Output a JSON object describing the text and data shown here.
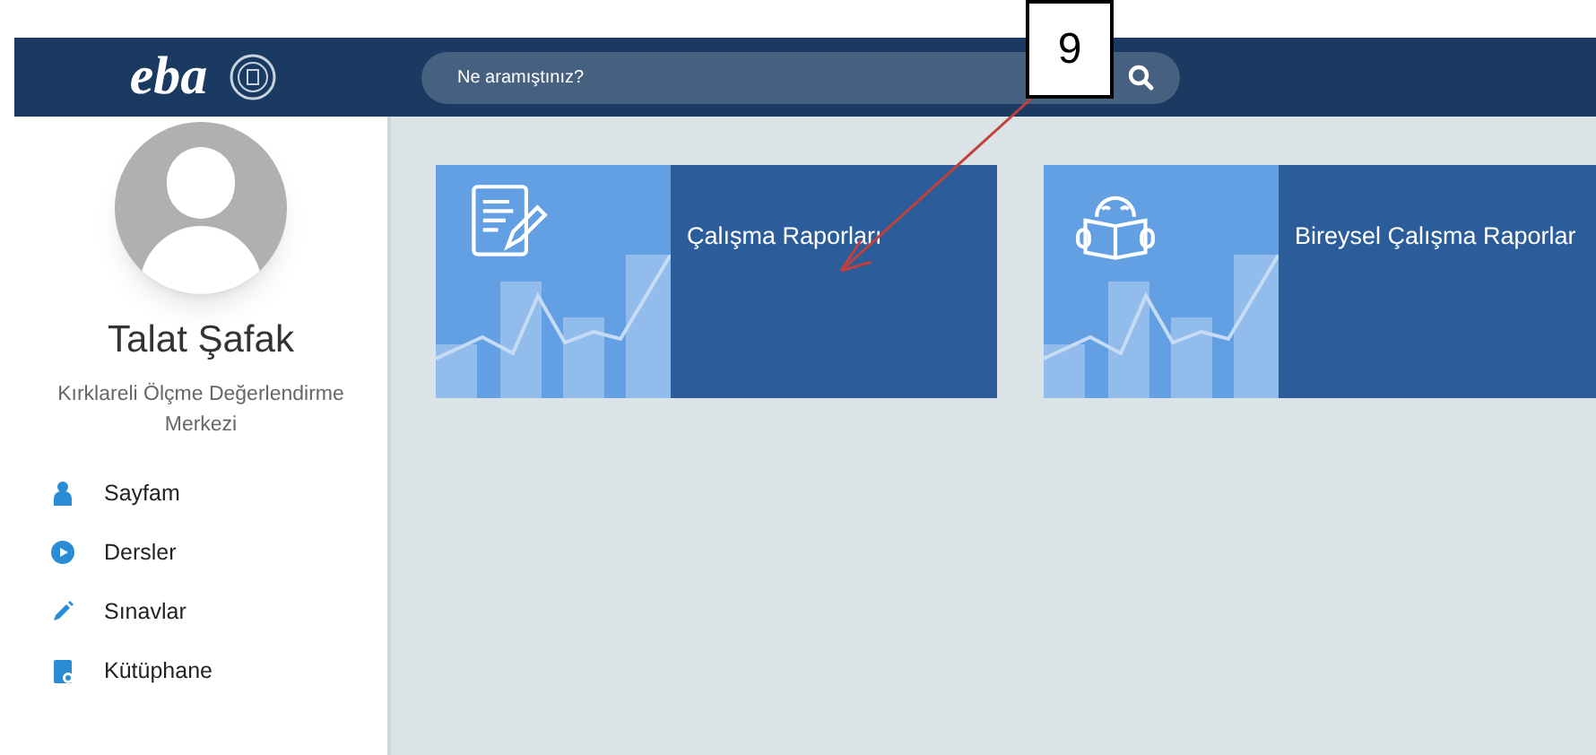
{
  "header": {
    "logo": "eba",
    "search": {
      "placeholder": "Ne aramıştınız?"
    }
  },
  "profile": {
    "name": "Talat Şafak",
    "organization": "Kırklareli Ölçme Değerlendirme Merkezi"
  },
  "menu": [
    {
      "label": "Sayfam",
      "kind": "user"
    },
    {
      "label": "Dersler",
      "kind": "play"
    },
    {
      "label": "Sınavlar",
      "kind": "pencil"
    },
    {
      "label": "Kütüphane",
      "kind": "library"
    }
  ],
  "cards": [
    {
      "title": "Çalışma Raporları",
      "kind": "report"
    },
    {
      "title": "Bireysel Çalışma Raporlar",
      "kind": "reader"
    }
  ],
  "callout": {
    "label": "9"
  }
}
